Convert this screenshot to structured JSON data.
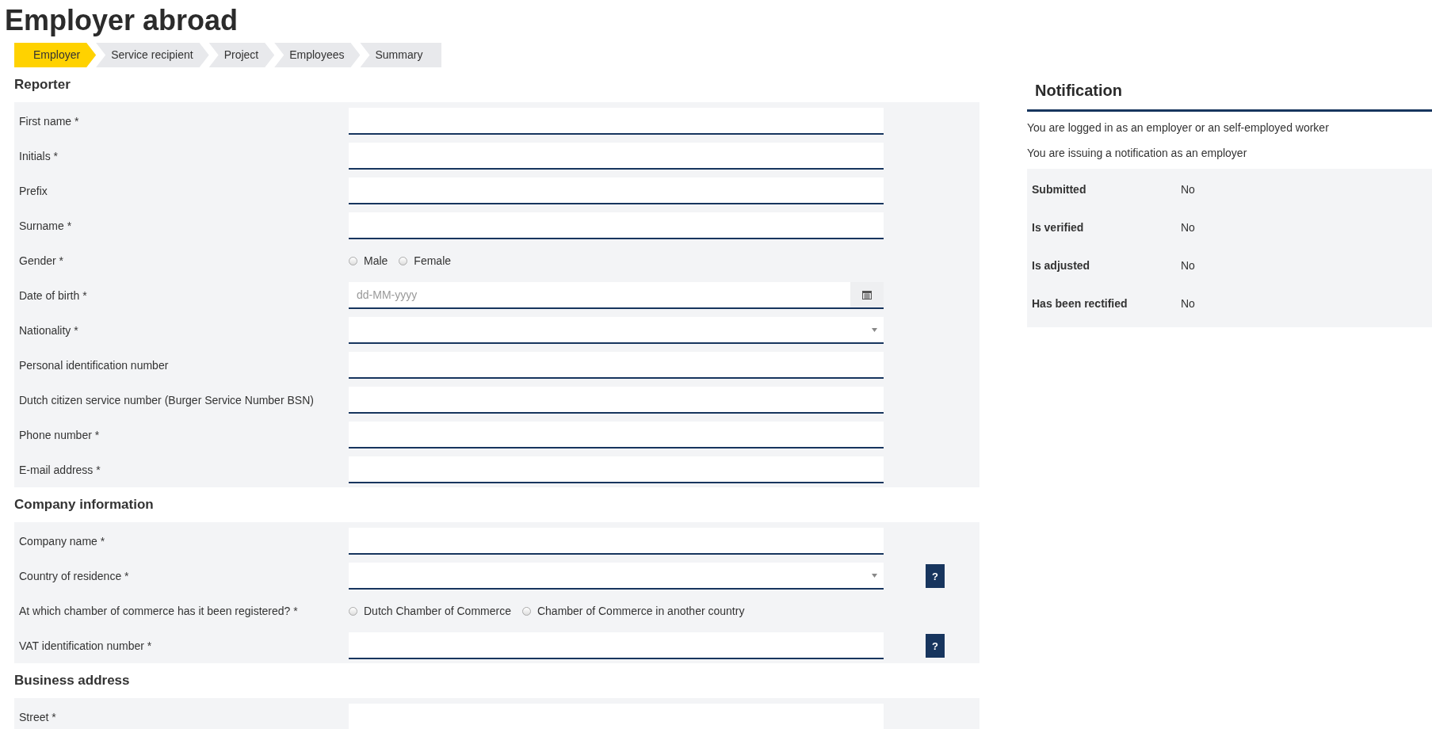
{
  "page_title": "Employer abroad",
  "steps": [
    {
      "label": "Employer",
      "selected": true
    },
    {
      "label": "Service recipient",
      "selected": false
    },
    {
      "label": "Project",
      "selected": false
    },
    {
      "label": "Employees",
      "selected": false
    },
    {
      "label": "Summary",
      "selected": false
    }
  ],
  "sections": [
    {
      "title": "Reporter",
      "fields": [
        {
          "label": "First name *",
          "kind": "text"
        },
        {
          "label": "Initials *",
          "kind": "text"
        },
        {
          "label": "Prefix",
          "kind": "text"
        },
        {
          "label": "Surname *",
          "kind": "text"
        },
        {
          "label": "Gender *",
          "kind": "radio",
          "options": [
            {
              "label": "Male",
              "selected": false
            },
            {
              "label": "Female",
              "selected": false
            }
          ]
        },
        {
          "label": "Date of birth *",
          "kind": "date",
          "placeholder": "dd-MM-yyyy"
        },
        {
          "label": "Nationality *",
          "kind": "select"
        },
        {
          "label": "Personal identification number",
          "kind": "text"
        },
        {
          "label": "Dutch citizen service number (Burger Service Number BSN)",
          "kind": "text"
        },
        {
          "label": "Phone number *",
          "kind": "text"
        },
        {
          "label": "E-mail address *",
          "kind": "text"
        }
      ]
    },
    {
      "title": "Company information",
      "fields": [
        {
          "label": "Company name *",
          "kind": "text"
        },
        {
          "label": "Country of residence *",
          "kind": "select",
          "help": "?"
        },
        {
          "label": "At which chamber of commerce has it been registered? *",
          "kind": "radio",
          "options": [
            {
              "label": "Dutch Chamber of Commerce",
              "selected": false
            },
            {
              "label": "Chamber of Commerce in another country",
              "selected": false
            }
          ]
        },
        {
          "label": "VAT identification number *",
          "kind": "text",
          "help": "?"
        }
      ]
    },
    {
      "title": "Business address",
      "fields": [
        {
          "label": "Street *",
          "kind": "text"
        }
      ]
    }
  ],
  "notification": {
    "title": "Notification",
    "messages": [
      "You are logged in as an employer or an self-employed worker",
      "You are issuing a notification as an employer"
    ],
    "status": [
      {
        "label": "Submitted",
        "value": "No"
      },
      {
        "label": "Is verified",
        "value": "No"
      },
      {
        "label": "Is adjusted",
        "value": "No"
      },
      {
        "label": "Has been rectified",
        "value": "No"
      }
    ]
  }
}
